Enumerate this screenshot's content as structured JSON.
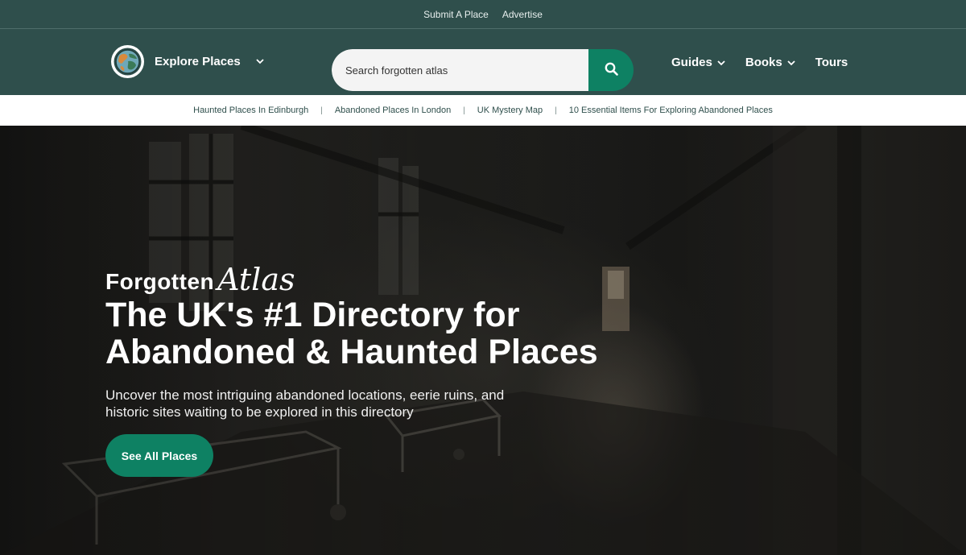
{
  "topbar": {
    "links": [
      "Submit A Place",
      "Advertise"
    ]
  },
  "nav": {
    "brand_label": "Explore Places",
    "search": {
      "placeholder": "Search forgotten atlas"
    },
    "items": [
      "Guides",
      "Books",
      "Tours"
    ]
  },
  "subnav": {
    "links": [
      "Haunted Places In Edinburgh",
      "Abandoned Places In London",
      "UK Mystery Map",
      "10 Essential Items For Exploring Abandoned Places"
    ],
    "separator": "|"
  },
  "hero": {
    "logo_word1": "Forgotten",
    "logo_word2": "Atlas",
    "headline_line1": "The UK's #1 Directory for",
    "headline_line2": "Abandoned & Haunted Places",
    "subtext_line1": "Uncover the most intriguing abandoned locations, eerie ruins, and",
    "subtext_line2": "historic sites waiting to be explored in this directory",
    "cta_label": "See All Places"
  },
  "colors": {
    "dark_green": "#2f4f4c",
    "accent_green": "#0e8163",
    "white": "#ffffff"
  }
}
